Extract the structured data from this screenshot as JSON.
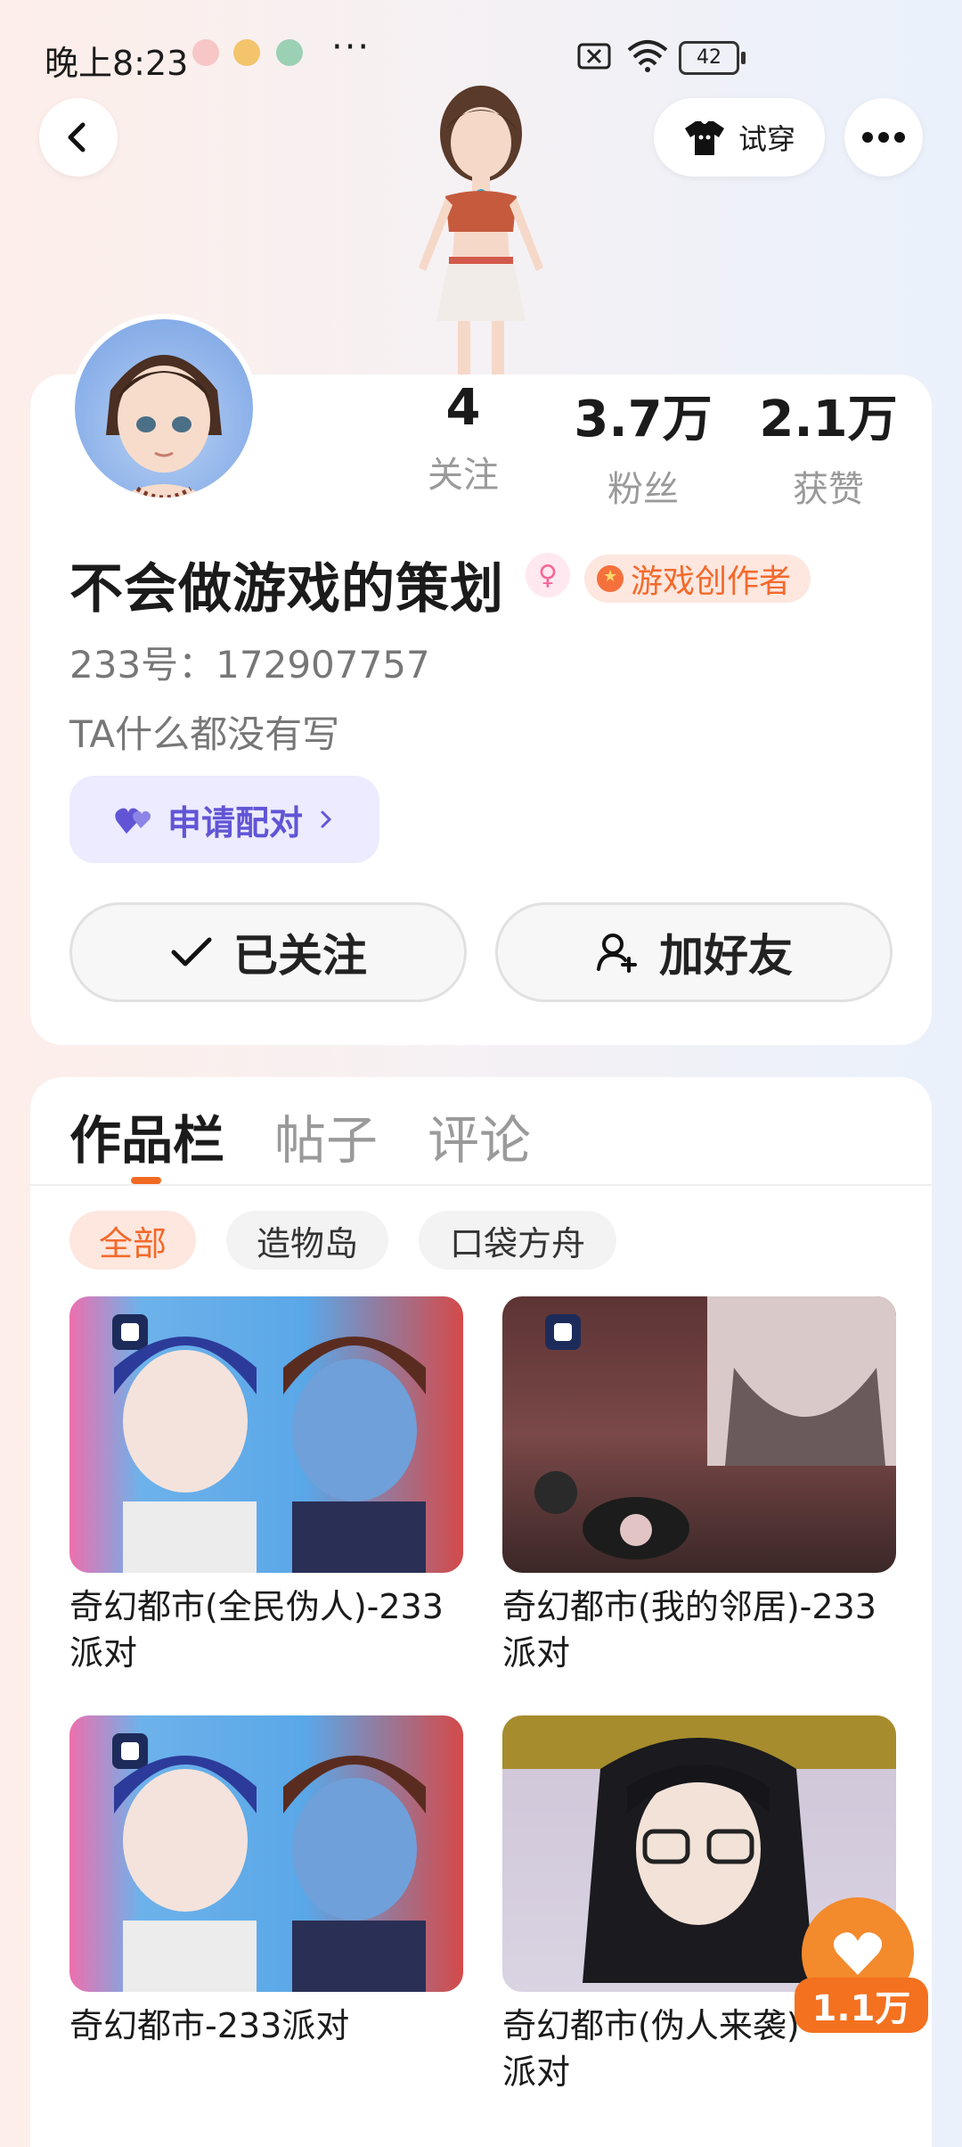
{
  "status_bar": {
    "time": "晚上8:23",
    "dots": "···",
    "battery": "42"
  },
  "top_bar": {
    "try_on_label": "试穿"
  },
  "profile": {
    "username": "不会做游戏的策划",
    "gender_icon": "female-icon",
    "creator_badge": "游戏创作者",
    "id_text": "233号：172907757",
    "bio": "TA什么都没有写",
    "pair_button": "申请配对",
    "stats": [
      {
        "value": "4",
        "label": "关注"
      },
      {
        "value": "3.7万",
        "label": "粉丝"
      },
      {
        "value": "2.1万",
        "label": "获赞"
      }
    ],
    "follow_button": "已关注",
    "add_friend_button": "加好友"
  },
  "tabs": [
    {
      "label": "作品栏",
      "active": true
    },
    {
      "label": "帖子",
      "active": false
    },
    {
      "label": "评论",
      "active": false
    }
  ],
  "filter_chips": [
    {
      "label": "全部",
      "active": true
    },
    {
      "label": "造物岛",
      "active": false
    },
    {
      "label": "口袋方舟",
      "active": false
    }
  ],
  "works": [
    {
      "title": "奇幻都市(全民伪人)-233\n派对"
    },
    {
      "title": "奇幻都市(我的邻居)-233\n派对"
    },
    {
      "title": "奇幻都市-233派对"
    },
    {
      "title": "奇幻都市(伪人来袭)\n派对"
    }
  ],
  "floating_like": {
    "count": "1.1万"
  },
  "colors": {
    "accent": "#f06a21",
    "pair": "#6155d6",
    "badge": "#f36a2c"
  }
}
